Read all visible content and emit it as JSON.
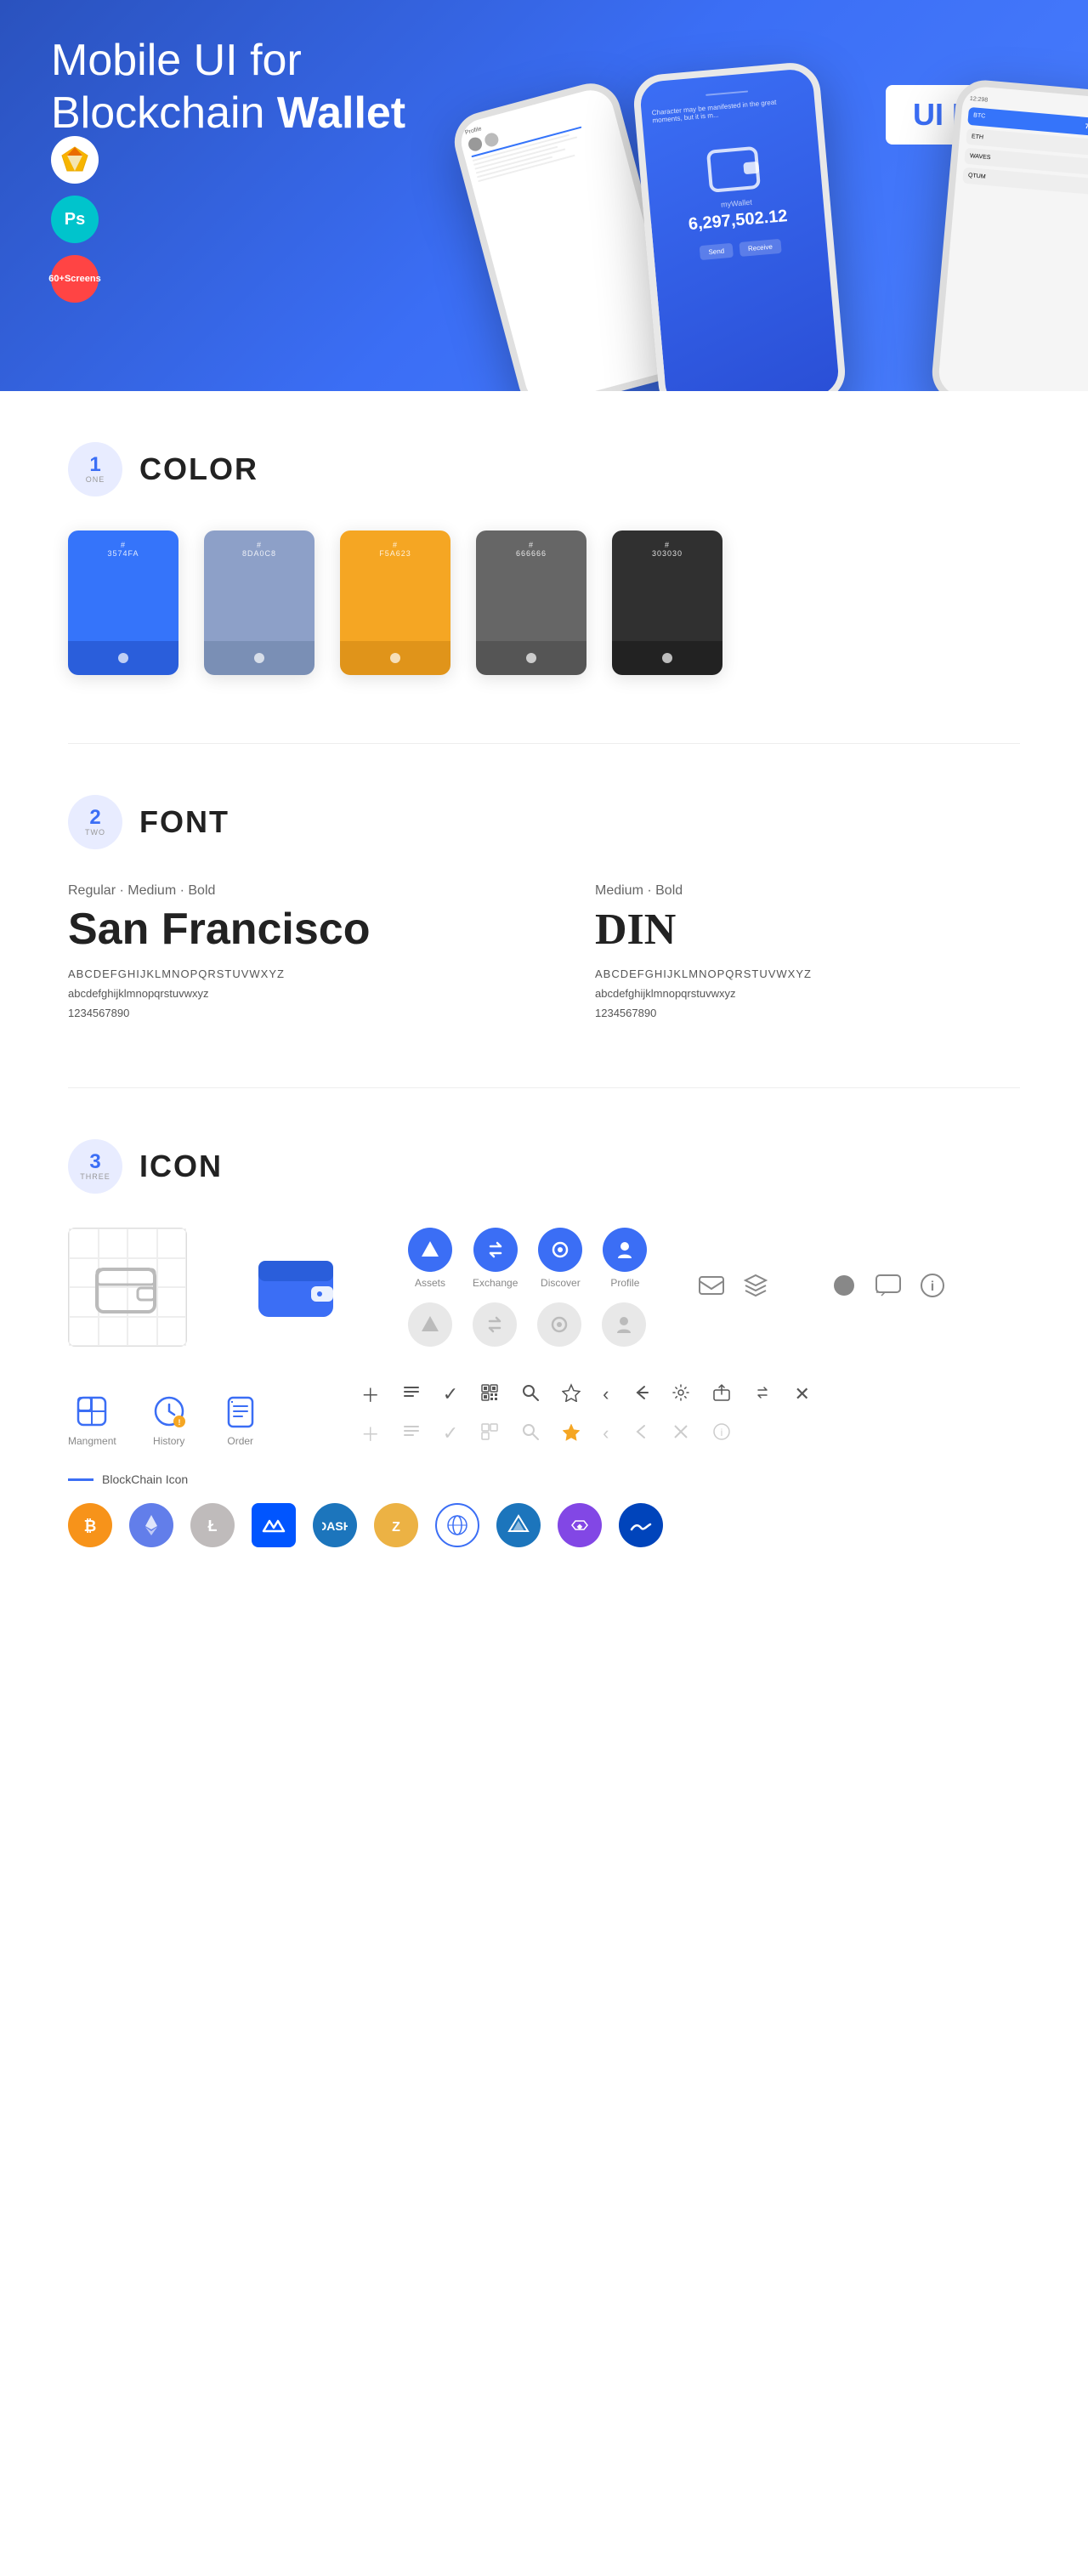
{
  "hero": {
    "title_regular": "Mobile UI for Blockchain ",
    "title_bold": "Wallet",
    "badge": "UI Kit",
    "sketch_label": "Sketch",
    "ps_label": "Ps",
    "screens_line1": "60+",
    "screens_line2": "Screens",
    "phone_amount": "6,297,502.12",
    "phone_currency": "myWallet"
  },
  "sections": {
    "color": {
      "number": "1",
      "sub": "ONE",
      "title": "COLOR",
      "swatches": [
        {
          "hex": "#3574FA",
          "label": "# 3574FA",
          "bg": "#3574FA"
        },
        {
          "hex": "#8DA0C8",
          "label": "# 8DA0C8",
          "bg": "#8DA0C8"
        },
        {
          "hex": "#F5A623",
          "label": "# F5A623",
          "bg": "#F5A623"
        },
        {
          "hex": "#666666",
          "label": "# 666666",
          "bg": "#666666"
        },
        {
          "hex": "#303030",
          "label": "# 303030",
          "bg": "#303030"
        }
      ]
    },
    "font": {
      "number": "2",
      "sub": "TWO",
      "title": "FONT",
      "font1": {
        "label": "Regular · Medium · Bold",
        "name": "San Francisco",
        "uppercase": "ABCDEFGHIJKLMNOPQRSTUVWXYZ",
        "lowercase": "abcdefghijklmnopqrstuvwxyz",
        "numbers": "1234567890"
      },
      "font2": {
        "label": "Medium · Bold",
        "name": "DIN",
        "uppercase": "ABCDEFGHIJKLMNOPQRSTUVWXYZ",
        "lowercase": "abcdefghijklmnopqrstuvwxyz",
        "numbers": "1234567890"
      }
    },
    "icon": {
      "number": "3",
      "sub": "THREE",
      "title": "ICON",
      "nav_icons": [
        {
          "label": "Assets"
        },
        {
          "label": "Exchange"
        },
        {
          "label": "Discover"
        },
        {
          "label": "Profile"
        }
      ],
      "bottom_nav": [
        {
          "label": "Mangment"
        },
        {
          "label": "History"
        },
        {
          "label": "Order"
        }
      ],
      "blockchain_label": "BlockChain Icon",
      "crypto_labels": [
        "BTC",
        "ETH",
        "LTC",
        "WAVES",
        "DASH",
        "ZEC",
        "WorldCoin",
        "STRAT",
        "Polygon",
        "Waves2"
      ]
    }
  }
}
